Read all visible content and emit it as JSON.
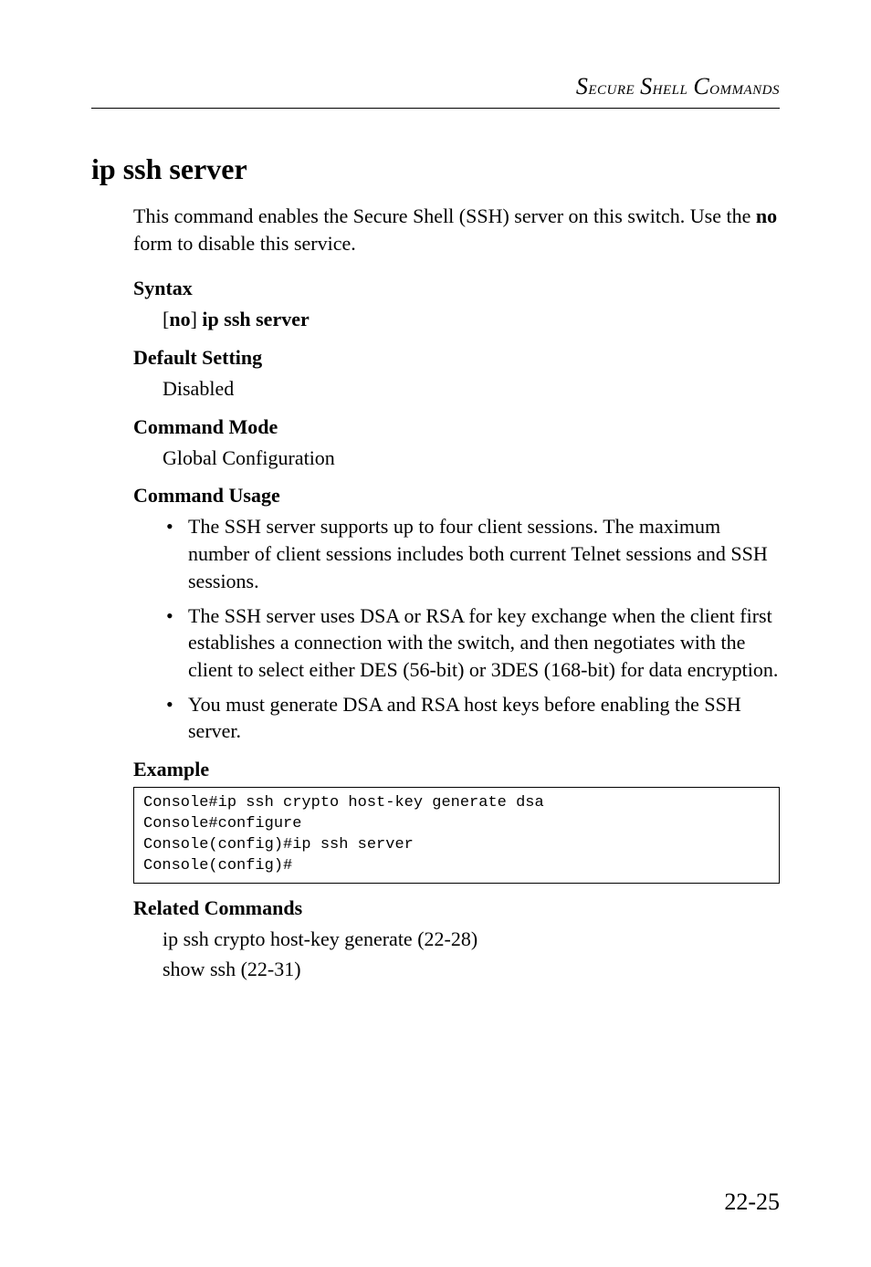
{
  "running_head": {
    "text": "Secure Shell Commands"
  },
  "title": "ip ssh server",
  "intro": {
    "pre": "This command enables the Secure Shell (SSH) server on this switch. Use the ",
    "bold": "no",
    "post": " form to disable this service."
  },
  "syntax": {
    "label": "Syntax",
    "line": {
      "open": "[",
      "no": "no",
      "close": "]",
      "rest": " ip ssh server"
    }
  },
  "default_setting": {
    "label": "Default Setting",
    "value": "Disabled"
  },
  "command_mode": {
    "label": "Command Mode",
    "value": "Global Configuration"
  },
  "command_usage": {
    "label": "Command Usage",
    "items": [
      "The SSH server supports up to four client sessions. The maximum number of client sessions includes both current Telnet sessions and SSH sessions.",
      "The SSH server uses DSA or RSA for key exchange when the client first establishes a connection with the switch, and then negotiates with the client to select either DES (56-bit) or 3DES (168-bit) for data encryption.",
      "You must generate DSA and RSA host keys before enabling the SSH server."
    ]
  },
  "example": {
    "label": "Example",
    "code": "Console#ip ssh crypto host-key generate dsa\nConsole#configure\nConsole(config)#ip ssh server\nConsole(config)#"
  },
  "related": {
    "label": "Related Commands",
    "lines": [
      "ip ssh crypto host-key generate (22-28)",
      "show ssh (22-31)"
    ]
  },
  "page_number": "22-25"
}
